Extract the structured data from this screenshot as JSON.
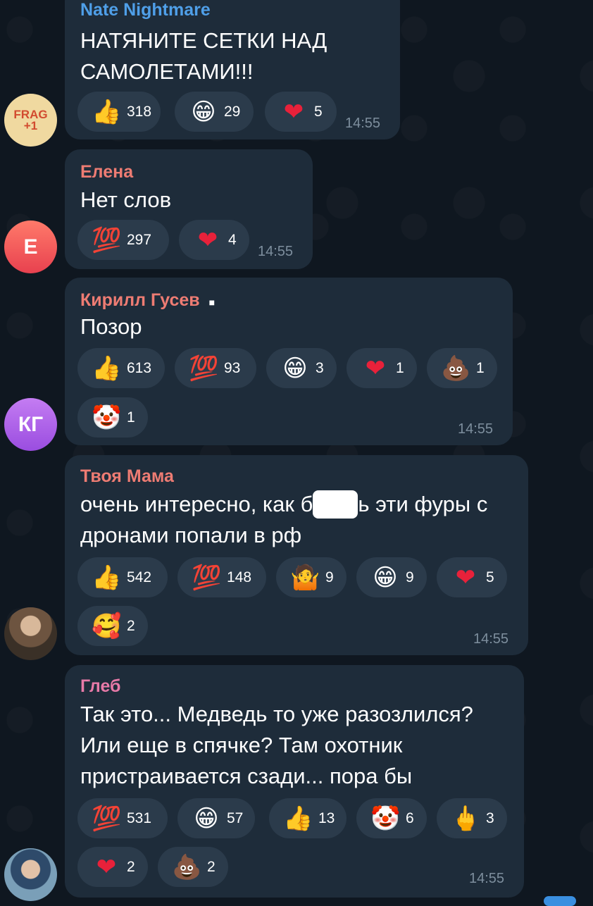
{
  "colors": {
    "background": "#0f1720",
    "bubble": "#1e2c3a",
    "chip": "#2b3b4b",
    "time": "#7d8e9d"
  },
  "messages": [
    {
      "sender": "Nate Nightmare",
      "sender_color": "#4f9fe8",
      "lines": [
        "НАТЯНИТЕ СЕТКИ НАД",
        "САМОЛЕТАМИ!!!"
      ],
      "time": "14:55",
      "avatar": {
        "type": "logo",
        "text": "FRAG +1"
      },
      "reactions": [
        {
          "icon": "thumbs-up-icon",
          "emoji": "👍",
          "count": "318"
        },
        {
          "icon": "grinning-face-icon",
          "emoji": "😁",
          "count": "29"
        },
        {
          "icon": "red-heart-icon",
          "emoji": "❤",
          "count": "5"
        }
      ]
    },
    {
      "sender": "Елена",
      "sender_color": "#ee7c73",
      "lines": [
        "Нет слов"
      ],
      "time": "14:55",
      "avatar": {
        "type": "initials",
        "text": "Е"
      },
      "reactions": [
        {
          "icon": "hundred-points-icon",
          "emoji": "💯",
          "count": "297"
        },
        {
          "icon": "red-heart-icon",
          "emoji": "❤",
          "count": "4"
        }
      ]
    },
    {
      "sender": "Кирилл Гусев",
      "sender_color": "#ee7c73",
      "badge": "■",
      "lines": [
        "Позор"
      ],
      "time": "14:55",
      "avatar": {
        "type": "initials",
        "text": "КГ"
      },
      "reactions": [
        {
          "icon": "thumbs-up-icon",
          "emoji": "👍",
          "count": "613"
        },
        {
          "icon": "hundred-points-icon",
          "emoji": "💯",
          "count": "93"
        },
        {
          "icon": "grinning-face-icon",
          "emoji": "😁",
          "count": "3"
        },
        {
          "icon": "red-heart-icon",
          "emoji": "❤",
          "count": "1"
        },
        {
          "icon": "pile-of-poo-icon",
          "emoji": "💩",
          "count": "1"
        },
        {
          "icon": "clown-face-icon",
          "emoji": "🤡",
          "count": "1"
        }
      ]
    },
    {
      "sender": "Твоя Мама",
      "sender_color": "#ee7c73",
      "lines": [
        "очень интересно, как б",
        "ь эти фуры с",
        "дронами попали в рф"
      ],
      "time": "14:55",
      "avatar": {
        "type": "photo"
      },
      "reactions": [
        {
          "icon": "thumbs-up-icon",
          "emoji": "👍",
          "count": "542"
        },
        {
          "icon": "hundred-points-icon",
          "emoji": "💯",
          "count": "148"
        },
        {
          "icon": "person-shrugging-icon",
          "emoji": "🤷",
          "count": "9"
        },
        {
          "icon": "grinning-face-icon",
          "emoji": "😁",
          "count": "9"
        },
        {
          "icon": "red-heart-icon",
          "emoji": "❤",
          "count": "5"
        },
        {
          "icon": "smiling-face-with-hearts-icon",
          "emoji": "🥰",
          "count": "2"
        }
      ]
    },
    {
      "sender": "Глеб",
      "sender_color": "#e87aa8",
      "lines": [
        "Так это... Медведь то уже разозлился?",
        "Или еще в спячке? Там охотник",
        "пристраивается сзади... пора бы"
      ],
      "time": "14:55",
      "avatar": {
        "type": "photo"
      },
      "reactions": [
        {
          "icon": "hundred-points-icon",
          "emoji": "💯",
          "count": "531"
        },
        {
          "icon": "grinning-face-icon",
          "emoji": "😁",
          "count": "57"
        },
        {
          "icon": "thumbs-up-icon",
          "emoji": "👍",
          "count": "13"
        },
        {
          "icon": "clown-face-icon",
          "emoji": "🤡",
          "count": "6"
        },
        {
          "icon": "middle-finger-icon",
          "emoji": "🖕",
          "count": "3"
        },
        {
          "icon": "red-heart-icon",
          "emoji": "❤",
          "count": "2"
        },
        {
          "icon": "pile-of-poo-icon",
          "emoji": "💩",
          "count": "2"
        }
      ]
    }
  ]
}
